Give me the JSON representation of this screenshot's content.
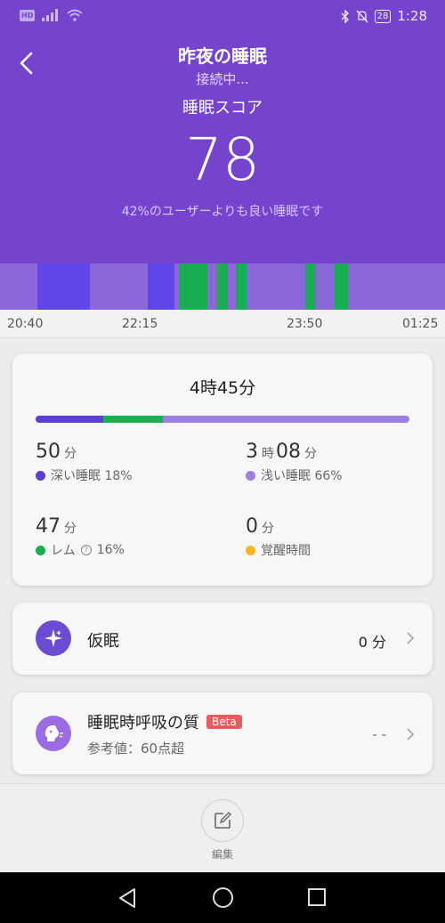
{
  "status": {
    "hd": "HD",
    "battery": "28",
    "time": "1:28"
  },
  "header": {
    "title": "昨夜の睡眠",
    "subtitle": "接続中...",
    "score_label": "睡眠スコア",
    "score": "78",
    "compare": "42%のユーザーよりも良い睡眠です"
  },
  "graph": {
    "stage_colors": {
      "light": "#8a68db",
      "deep": "#6246e8",
      "rem": "#1aae53"
    },
    "segments": [
      {
        "stage": "light",
        "from": 0.0,
        "to": 0.084
      },
      {
        "stage": "deep",
        "from": 0.084,
        "to": 0.202
      },
      {
        "stage": "light",
        "from": 0.202,
        "to": 0.332
      },
      {
        "stage": "deep",
        "from": 0.332,
        "to": 0.392
      },
      {
        "stage": "light",
        "from": 0.392,
        "to": 0.402
      },
      {
        "stage": "rem",
        "from": 0.402,
        "to": 0.466
      },
      {
        "stage": "light",
        "from": 0.466,
        "to": 0.486
      },
      {
        "stage": "rem",
        "from": 0.486,
        "to": 0.512
      },
      {
        "stage": "light",
        "from": 0.512,
        "to": 0.53
      },
      {
        "stage": "rem",
        "from": 0.53,
        "to": 0.554
      },
      {
        "stage": "light",
        "from": 0.554,
        "to": 0.686
      },
      {
        "stage": "rem",
        "from": 0.686,
        "to": 0.708
      },
      {
        "stage": "light",
        "from": 0.708,
        "to": 0.752
      },
      {
        "stage": "rem",
        "from": 0.752,
        "to": 0.782
      },
      {
        "stage": "light",
        "from": 0.782,
        "to": 1.0
      }
    ],
    "ticks": [
      "20:40",
      "22:15",
      "23:50",
      "01:25"
    ]
  },
  "summary": {
    "total": "4時45分",
    "ratio": {
      "deep": 18,
      "rem": 16,
      "light": 66
    },
    "deep": {
      "value": "50",
      "unit": "分",
      "label": "深い睡眠 18%",
      "color": "#5b3fd0"
    },
    "light": {
      "value": "3",
      "unit1": "時",
      "value2": "08",
      "unit2": "分",
      "label": "浅い睡眠 66%",
      "color": "#9b80e0"
    },
    "rem": {
      "value": "47",
      "unit": "分",
      "label": "レム",
      "help": "?",
      "pct": "16%",
      "color": "#1aae53"
    },
    "awake": {
      "value": "0",
      "unit": "分",
      "label": "覚醒時間",
      "color": "#f2b822"
    }
  },
  "nap": {
    "label": "仮眠",
    "value": "0 分",
    "icon": "sparkle-icon",
    "color": "#6c4bd3"
  },
  "breathing": {
    "label": "睡眠時呼吸の質",
    "badge": "Beta",
    "ref": "参考値：60点超",
    "value": "- -",
    "icon": "face-breath-icon",
    "color": "#9b6be3",
    "badge_color": "#e95c5c"
  },
  "bottom": {
    "edit_label": "編集"
  }
}
